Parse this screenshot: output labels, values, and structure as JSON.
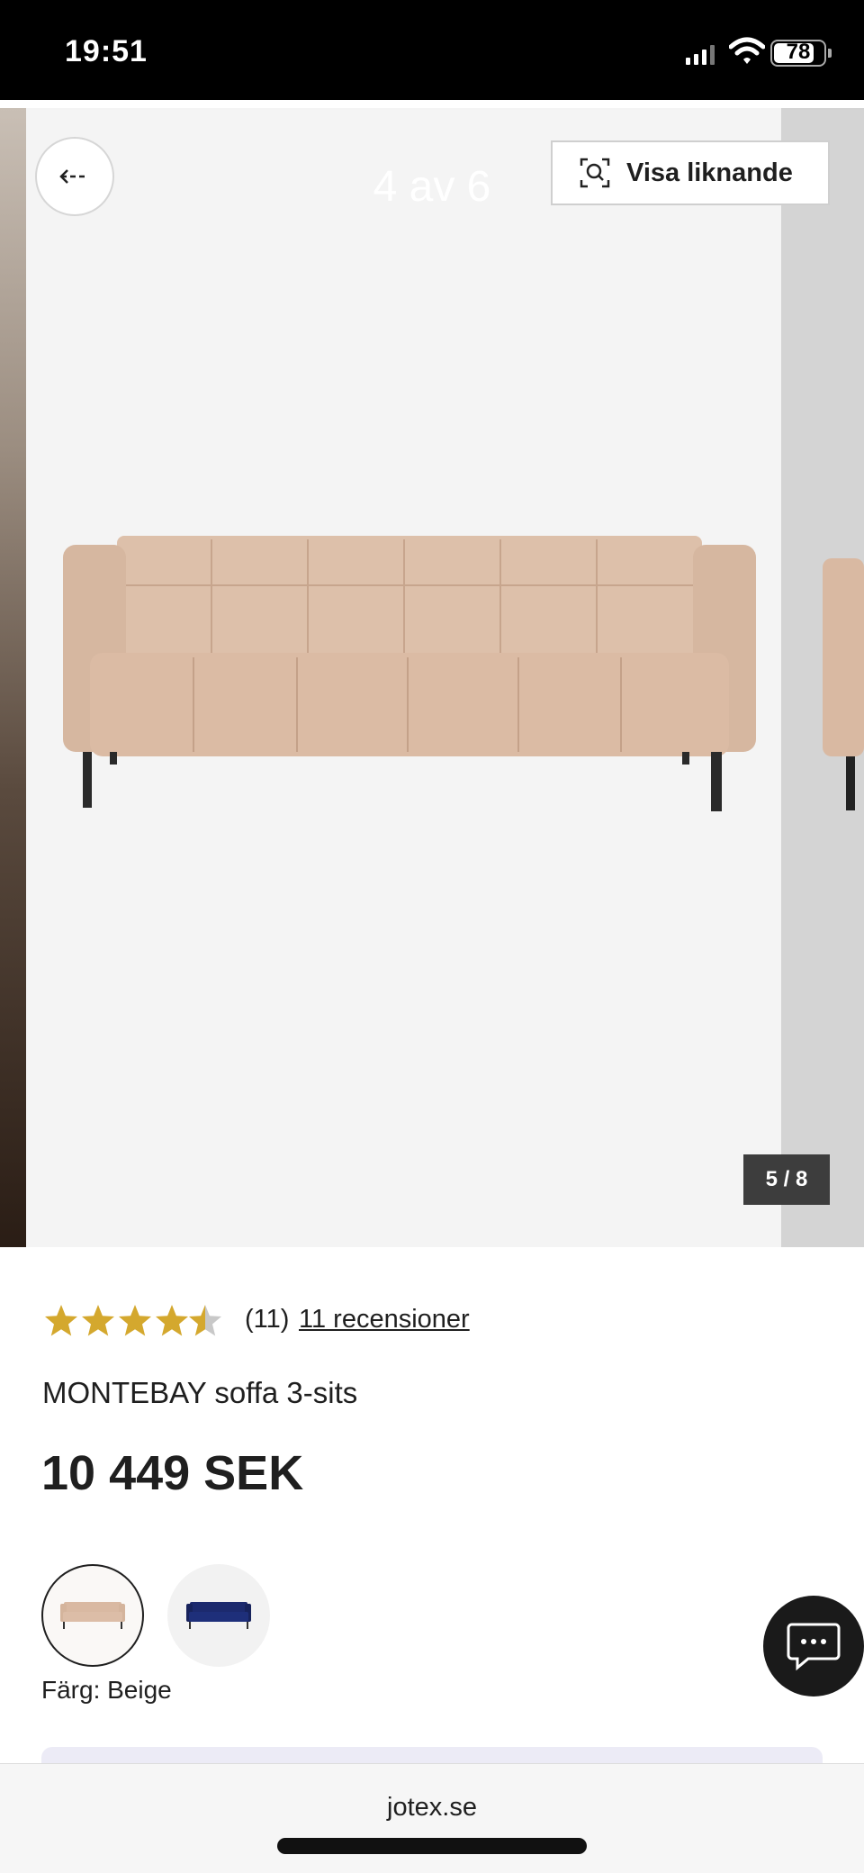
{
  "status_bar": {
    "time": "19:51",
    "battery": "78"
  },
  "gallery": {
    "image_counter": "4 av 6",
    "visa_liknande_label": "Visa liknande",
    "slide_counter": "5 / 8",
    "back_icon": "arrow-left-icon",
    "search_icon": "image-search-icon"
  },
  "product": {
    "rating": 4.5,
    "rating_count": "(11)",
    "reviews_link": "11 recensioner",
    "name": "MONTEBAY soffa 3-sits",
    "price": "10 449 SEK",
    "color_label": "Färg: Beige",
    "swatches": [
      "beige",
      "navy-blue"
    ]
  },
  "colors": {
    "star": "#d4a82e",
    "star_empty": "#c8c8c8",
    "sofa": "#d9b9a2",
    "swatch_blue": "#1c2a6e",
    "chat_bg": "#1a1a1a"
  },
  "browser": {
    "url": "jotex.se"
  }
}
